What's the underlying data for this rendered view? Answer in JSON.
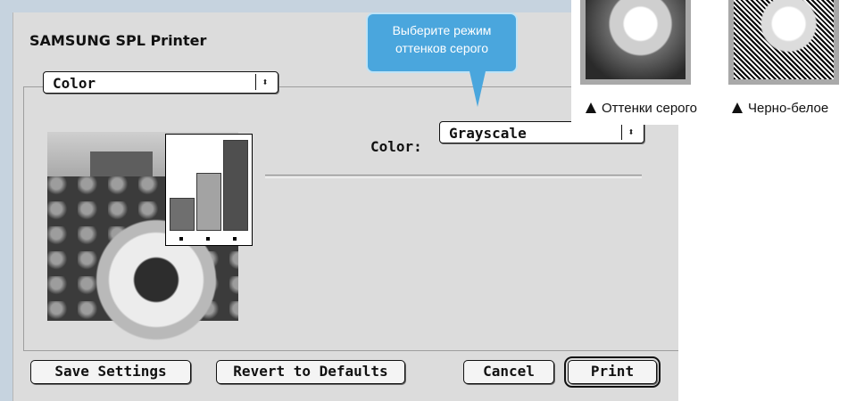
{
  "dialog": {
    "title": "SAMSUNG SPL Printer",
    "panel_popup": {
      "selected": "Color"
    },
    "color_label": "Color:",
    "color_popup": {
      "selected": "Grayscale"
    },
    "buttons": {
      "save_settings": "Save Settings",
      "revert_defaults": "Revert to Defaults",
      "cancel": "Cancel",
      "print": "Print"
    },
    "popup_arrow_glyph": "⬍"
  },
  "callout": {
    "line1": "Выберите режим",
    "line2": "оттенков серого",
    "color": "#4aa6dd"
  },
  "samples": {
    "grayscale_caption": "Оттенки серого",
    "bw_caption": "Черно-белое"
  },
  "preview_chart": {
    "bars": [
      {
        "level": 0.35,
        "color": "#6f6f6f"
      },
      {
        "level": 0.63,
        "color": "#a3a3a3"
      },
      {
        "level": 1.0,
        "color": "#4f4f4f"
      }
    ]
  }
}
